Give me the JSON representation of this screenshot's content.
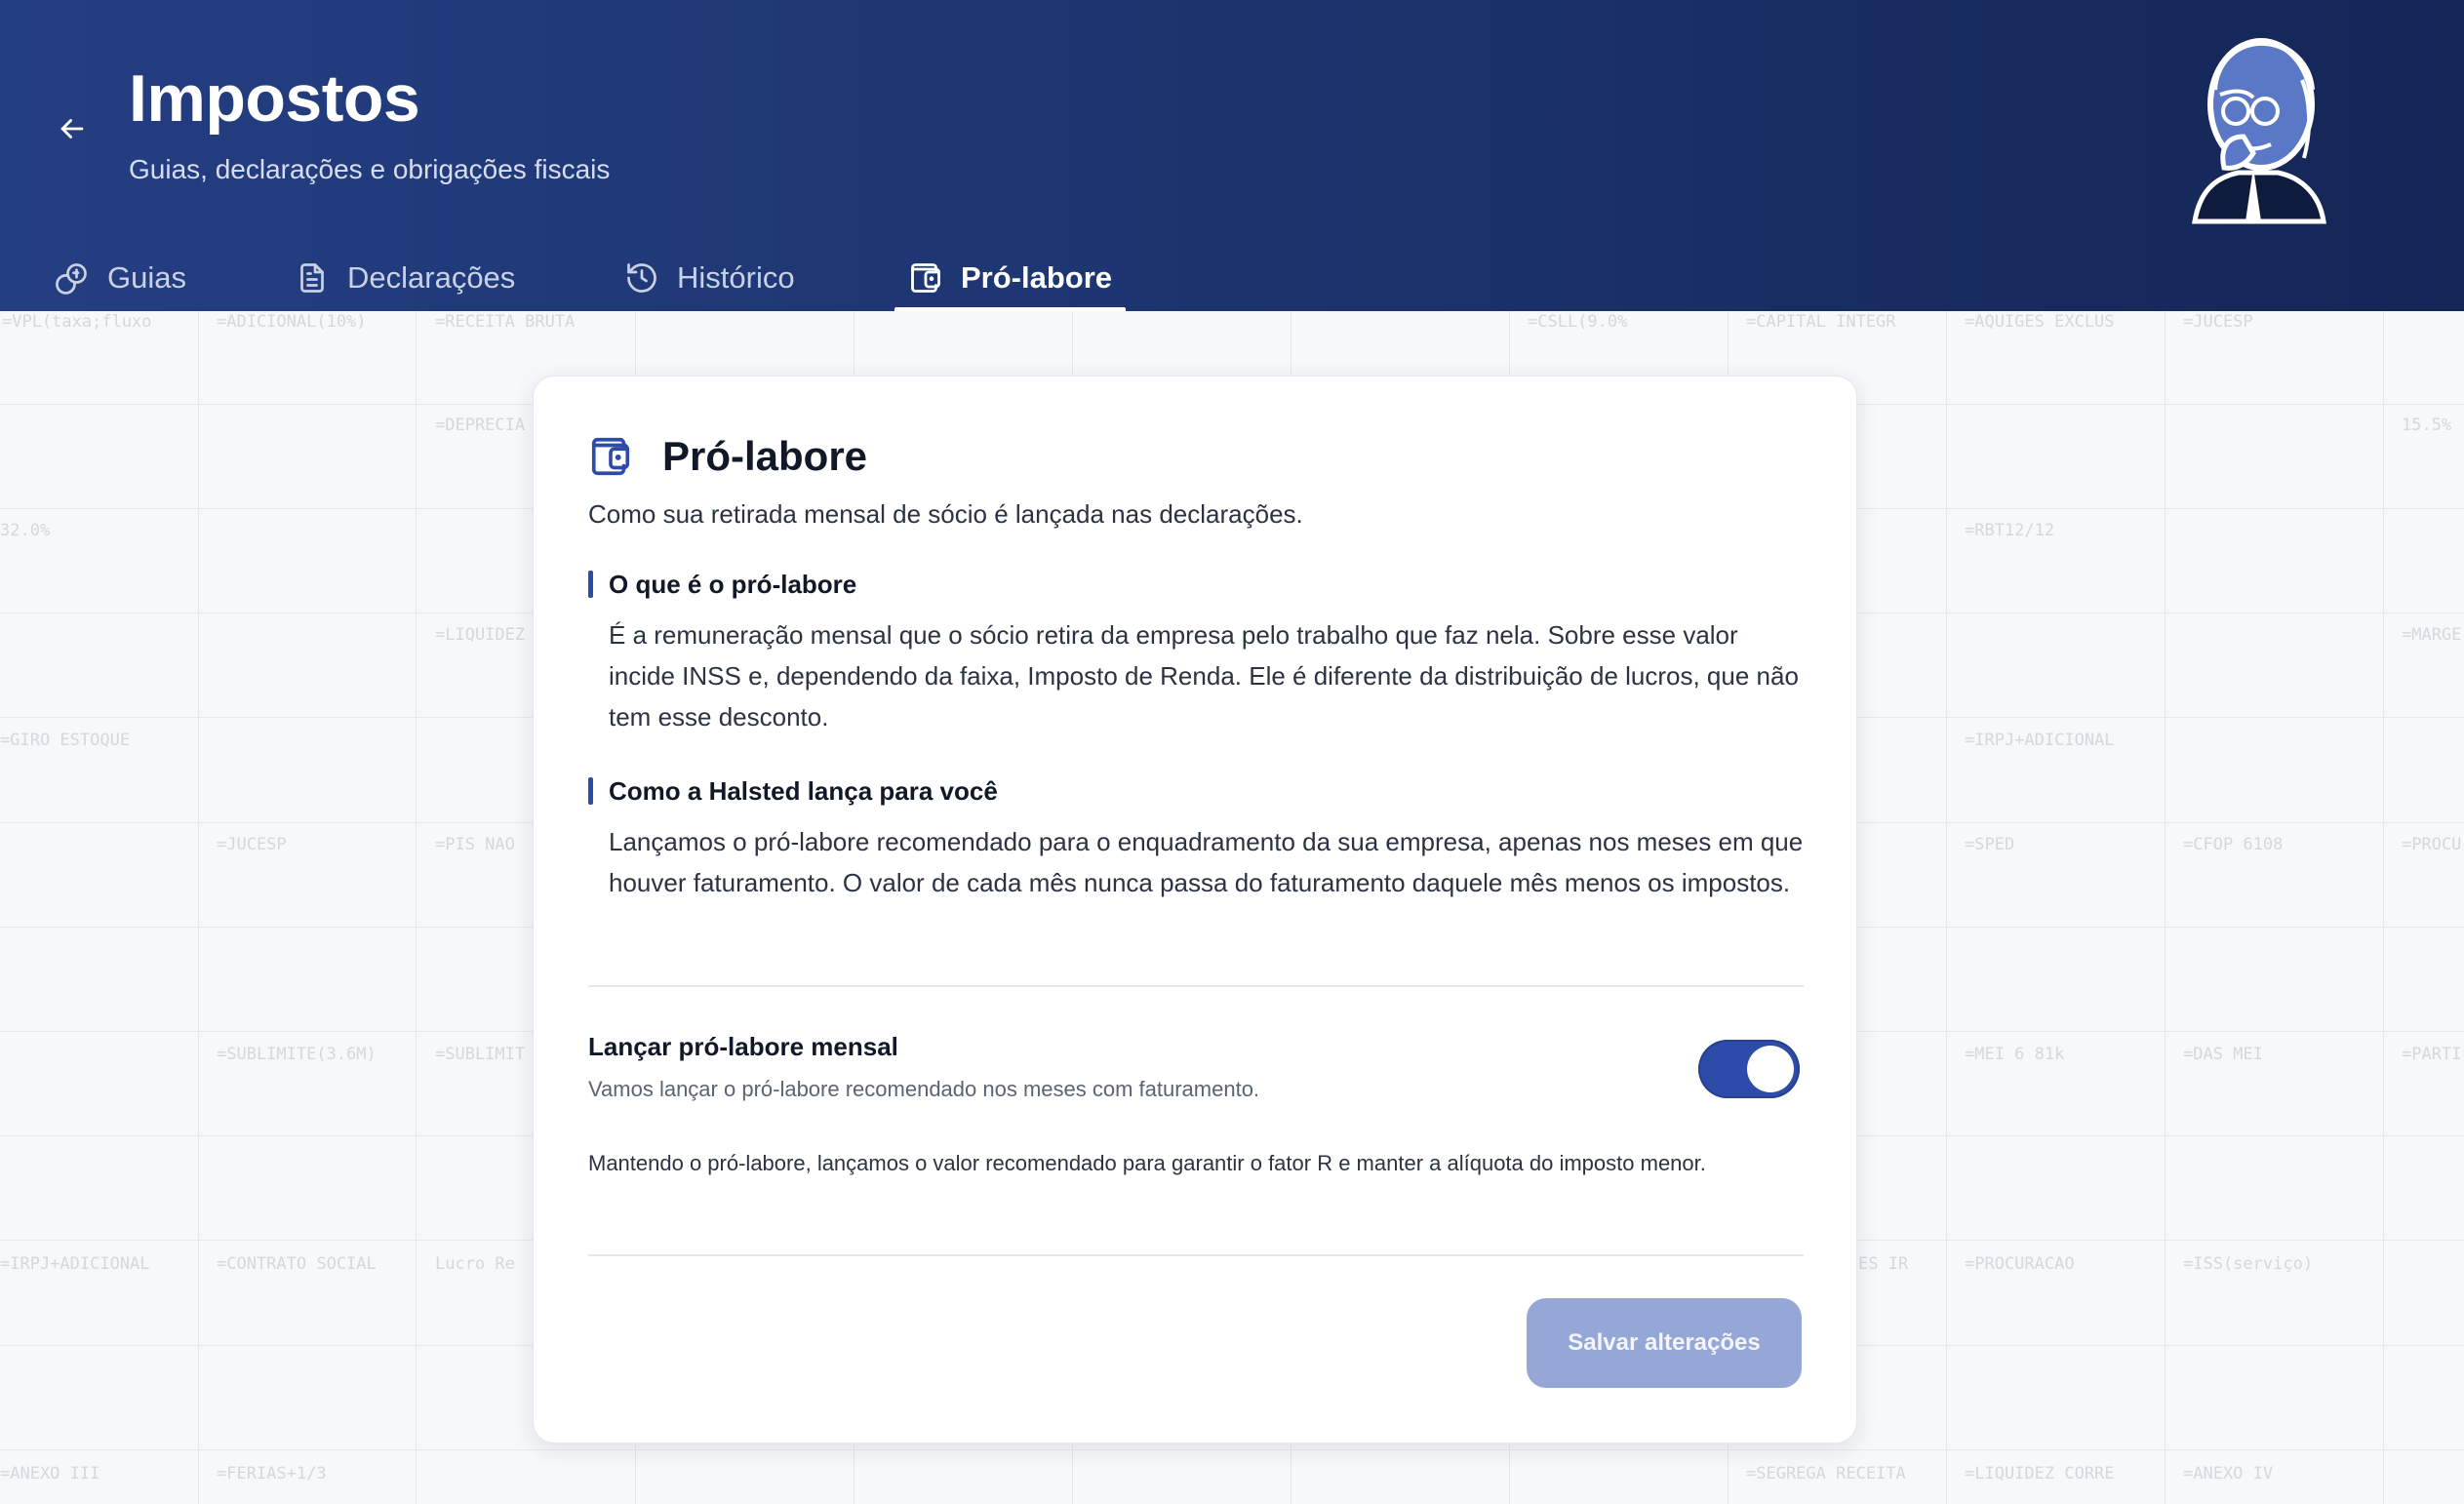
{
  "header": {
    "title": "Impostos",
    "subtitle": "Guias, declarações e obrigações fiscais",
    "back_icon": "arrow-left-icon",
    "mascot": "thinking-man-illustration"
  },
  "tabs": [
    {
      "label": "Guias",
      "icon": "coins-icon",
      "active": false
    },
    {
      "label": "Declarações",
      "icon": "document-icon",
      "active": false
    },
    {
      "label": "Histórico",
      "icon": "history-icon",
      "active": false
    },
    {
      "label": "Pró-labore",
      "icon": "wallet-icon",
      "active": true
    }
  ],
  "background_cells": [
    "=VPL(taxa;fluxo",
    "=ADICIONAL(10%)",
    "=RECEITA BRUTA",
    "=CSLL(9.0%",
    "=CAPITAL INTEGR",
    "=AQUIGES EXCLUS",
    "=JUCESP",
    "=DEPRECIA",
    "15.5%",
    "32.0%",
    "=RBT12/12",
    "=LIQUIDEZ",
    "=MARGE",
    "=GIRO ESTOQUE",
    "=IRPJ+ADICIONAL",
    "=JUCESP",
    "=PIS NAO",
    "=SPED",
    "=CFOP 6108",
    "=PROCU",
    "=SUBLIMITE(3.6M)",
    "=SUBLIMIT",
    "=MEI 6 81k",
    "=DAS MEI",
    "=PARTI",
    "=IRPJ+ADICIONAL",
    "=CONTRATO SOCIAL",
    "Lucro Re",
    "ES IR",
    "=PROCURACAO",
    "=ISS(serviço)",
    "=ANEXO III",
    "=FERIAS+1/3",
    "=SEGREGA RECEITA",
    "=LIQUIDEZ CORRE",
    "=ANEXO IV"
  ],
  "card": {
    "icon": "wallet-icon",
    "title": "Pró-labore",
    "description": "Como sua retirada mensal de sócio é lançada nas declarações.",
    "sections": [
      {
        "title": "O que é o pró-labore",
        "text": "É a remuneração mensal que o sócio retira da empresa pelo trabalho que faz nela. Sobre esse valor incide INSS e, dependendo da faixa, Imposto de Renda. Ele é diferente da distribuição de lucros, que não tem esse desconto."
      },
      {
        "title": "Como a Halsted lança para você",
        "text": "Lançamos o pró-labore recomendado para o enquadramento da sua empresa, apenas nos meses em que houver faturamento. O valor de cada mês nunca passa do faturamento daquele mês menos os impostos."
      }
    ],
    "toggle": {
      "label": "Lançar pró-labore mensal",
      "help": "Vamos lançar o pró-labore recomendado nos meses com faturamento.",
      "checked": true
    },
    "note": "Mantendo o pró-labore, lançamos o valor recomendado para garantir o fator R e manter a alíquota do imposto menor.",
    "save_label": "Salvar alterações"
  },
  "colors": {
    "header_start": "#243e82",
    "header_end": "#142656",
    "accent": "#2d4ba8",
    "save_disabled": "#95a7d6"
  }
}
